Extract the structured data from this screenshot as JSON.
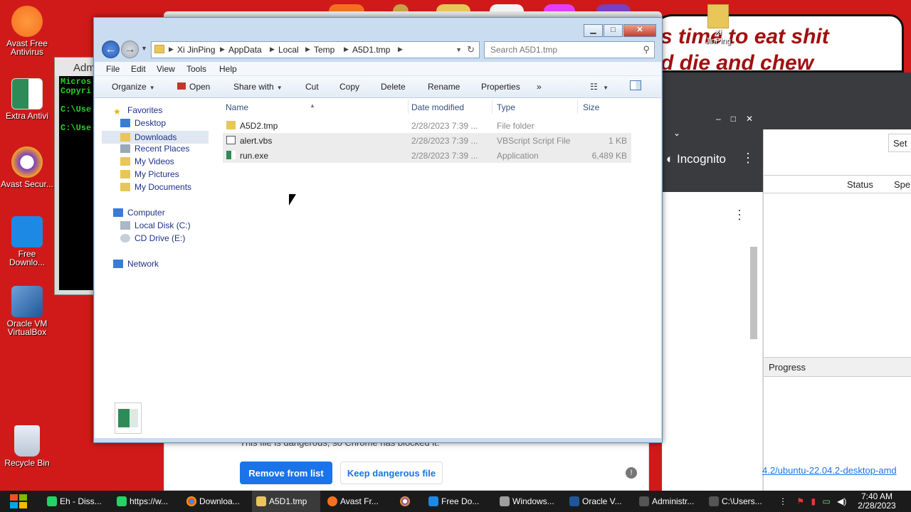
{
  "desktop": {
    "icons": [
      {
        "label": "Avast Free Antivirus"
      },
      {
        "label": "Extra Antivi"
      },
      {
        "label": "Avast Secur..."
      },
      {
        "label": "Free Downlo..."
      },
      {
        "label": "Oracle VM VirtualBox"
      },
      {
        "label": "Recycle Bin"
      }
    ],
    "banner_text": "s time to eat shit\nd die and chew",
    "banner_folder_label": "Xi JinPing",
    "cmd": {
      "title": "Adm",
      "lines": [
        "Micros",
        "Copyri",
        "",
        "C:\\Use",
        "",
        "C:\\Use"
      ]
    }
  },
  "browser": {
    "incognito": "Incognito",
    "settings_button": "Set",
    "columns": {
      "status": "Status",
      "speed": "Spe"
    },
    "progress_header": "Progress",
    "link_text": "4.2/ubuntu-22.04.2-desktop-amd",
    "download_msg": "This file is dangerous, so Chrome has blocked it.",
    "remove_button": "Remove from list",
    "keep_button": "Keep dangerous file"
  },
  "explorer": {
    "breadcrumb": [
      "Xi JinPing",
      "AppData",
      "Local",
      "Temp",
      "A5D1.tmp"
    ],
    "search_placeholder": "Search A5D1.tmp",
    "menu": [
      "File",
      "Edit",
      "View",
      "Tools",
      "Help"
    ],
    "toolbar": {
      "organize": "Organize",
      "open": "Open",
      "share_with": "Share with",
      "cut": "Cut",
      "copy": "Copy",
      "delete": "Delete",
      "rename": "Rename",
      "properties": "Properties",
      "more": "»"
    },
    "nav": {
      "favorites": "Favorites",
      "desktop": "Desktop",
      "downloads": "Downloads",
      "recent_places": "Recent Places",
      "my_videos": "My Videos",
      "my_pictures": "My Pictures",
      "my_documents": "My Documents",
      "computer": "Computer",
      "local_disk": "Local Disk (C:)",
      "cd_drive": "CD Drive (E:)",
      "network": "Network"
    },
    "columns": {
      "name": "Name",
      "date_modified": "Date modified",
      "type": "Type",
      "size": "Size"
    },
    "files": [
      {
        "name": "A5D2.tmp",
        "date": "2/28/2023 7:39 ...",
        "type": "File folder",
        "size": ""
      },
      {
        "name": "alert.vbs",
        "date": "2/28/2023 7:39 ...",
        "type": "VBScript Script File",
        "size": "1 KB"
      },
      {
        "name": "run.exe",
        "date": "2/28/2023 7:39 ...",
        "type": "Application",
        "size": "6,489 KB"
      }
    ]
  },
  "taskbar": {
    "tasks": [
      {
        "label": "Eh - Diss...",
        "color": "#25d366"
      },
      {
        "label": "https://w...",
        "color": "#25d366"
      },
      {
        "label": "Downloa...",
        "color": "#4285f4"
      },
      {
        "label": "A5D1.tmp",
        "color": "#e8c65a"
      },
      {
        "label": "Avast Fr...",
        "color": "#f37021"
      },
      {
        "label": "",
        "color": "#f5a623"
      },
      {
        "label": "Free Do...",
        "color": "#1e88e5"
      },
      {
        "label": "Windows...",
        "color": "#9e9e9e"
      },
      {
        "label": "Oracle V...",
        "color": "#1e5799"
      },
      {
        "label": "Administr...",
        "color": "#555555"
      },
      {
        "label": "C:\\Users...",
        "color": "#555555"
      }
    ],
    "time": "7:40 AM",
    "date": "2/28/2023"
  }
}
